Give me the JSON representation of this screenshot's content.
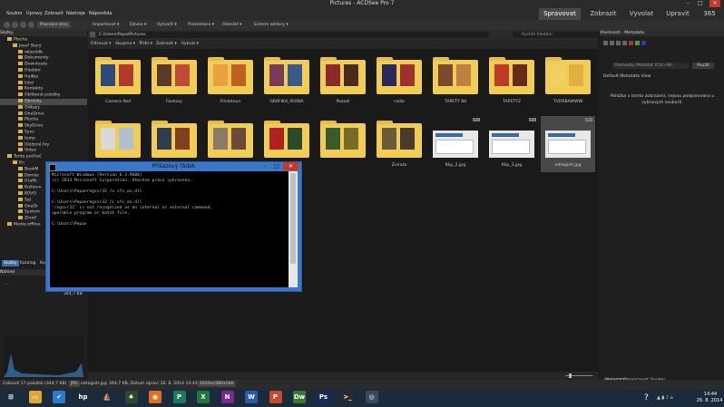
{
  "window": {
    "title": "Pictures - ACDSee Pro 7",
    "min": "–",
    "max": "□",
    "close": "✕"
  },
  "menu": [
    "Soubor",
    "Úpravy",
    "Zobrazit",
    "Nástroje",
    "Nápověda"
  ],
  "modes": [
    {
      "label": "Spravovat",
      "active": true
    },
    {
      "label": "Zobrazit"
    },
    {
      "label": "Vyvolat"
    },
    {
      "label": "Upravit"
    },
    {
      "label": "365"
    }
  ],
  "toolbar": {
    "items": [
      "Procesní stroj",
      "Importovat ▾",
      "Dávka ▾",
      "Vytvořit ▾",
      "Prezentace ▾",
      "Odeslat ▾",
      "Externí editory ▾"
    ]
  },
  "left_panel": {
    "header": "Složky",
    "tree": [
      {
        "label": "Plocha"
      },
      {
        "label": "Josef Starý"
      },
      {
        "label": "objectdb"
      },
      {
        "label": "Dokumenty"
      },
      {
        "label": "Downloads"
      },
      {
        "label": "Hledání"
      },
      {
        "label": "Hudba"
      },
      {
        "label": "Intel"
      },
      {
        "label": "Kontakty"
      },
      {
        "label": "Oblíbené položky"
      },
      {
        "label": "Obrázky",
        "selected": true
      },
      {
        "label": "Odkazy"
      },
      {
        "label": "OneDrive"
      },
      {
        "label": "Plocha"
      },
      {
        "label": "SkyDrive"
      },
      {
        "label": "Sync"
      },
      {
        "label": "temp"
      },
      {
        "label": "Uložené hry"
      },
      {
        "label": "Videa"
      },
      {
        "label": "Tento počítač"
      },
      {
        "label": "Kn"
      },
      {
        "label": "BookM"
      },
      {
        "label": "Domác"
      },
      {
        "label": "Grafik"
      },
      {
        "label": "Knihovn"
      },
      {
        "label": "KOVO"
      },
      {
        "label": "Sal"
      },
      {
        "label": "OneDr"
      },
      {
        "label": "System"
      },
      {
        "label": "ZinaV"
      },
      {
        "label": "Media offline"
      }
    ],
    "tabs": [
      "Složky",
      "Katalog",
      "Ka"
    ],
    "preview_header": "Náhled",
    "preview_placeholder": "--",
    "preview_size": "344,7 KB"
  },
  "path": "C:\\Users\\Pepa\\Pictures",
  "search_placeholder": "Rychlé hledání",
  "filter": [
    "Filtrovat ▾",
    "Skupina ▾",
    "Třídit ▾",
    "Zobrazit ▾",
    "Vybrat ▾"
  ],
  "thumbnails": [
    {
      "label": "Camera Roll",
      "kind": "folder",
      "pics": [
        "#2e4a7a",
        "#b03a2e"
      ]
    },
    {
      "label": "Fantasy",
      "kind": "folder",
      "pics": [
        "#5a3a2a",
        "#c04a3a"
      ]
    },
    {
      "label": "Flintstoun",
      "kind": "folder",
      "pics": [
        "#e8a040",
        "#c06020"
      ]
    },
    {
      "label": "GRAFIKA_PEKNA",
      "kind": "folder",
      "pics": [
        "#7a3a5a",
        "#3a5a8a"
      ]
    },
    {
      "label": "Pozadí",
      "kind": "folder",
      "pics": [
        "#8a2a2a",
        "#4a2a1a"
      ]
    },
    {
      "label": "radio",
      "kind": "folder",
      "pics": [
        "#2a2a5a",
        "#a03030"
      ]
    },
    {
      "label": "TAPETY 84",
      "kind": "folder",
      "pics": [
        "#7a4a2a",
        "#c08040"
      ]
    },
    {
      "label": "TAPETY2",
      "kind": "folder",
      "pics": [
        "#c03a2a",
        "#6a2a1a"
      ]
    },
    {
      "label": "TVORBAWWW",
      "kind": "folder",
      "pics": [
        "#f0d060",
        "#e0b040"
      ]
    },
    {
      "label": "",
      "kind": "folder",
      "pics": [
        "#d8d8d8",
        "#b0c0d0"
      ]
    },
    {
      "label": "",
      "kind": "folder",
      "pics": [
        "#303a50",
        "#804020"
      ]
    },
    {
      "label": "",
      "kind": "folder",
      "pics": [
        "#8a7a6a",
        "#6a4a3a"
      ]
    },
    {
      "label": "",
      "kind": "folder",
      "pics": [
        "#b02020",
        "#2a4a2a"
      ]
    },
    {
      "label": "",
      "kind": "folder",
      "pics": [
        "#3a5a2a",
        "#7a6a2a"
      ]
    },
    {
      "label": "Zvirata",
      "kind": "folder",
      "pics": [
        "#6a5a3a",
        "#4a3a2a"
      ]
    },
    {
      "label": "Klip_2.jpg",
      "kind": "jpg",
      "badge": "JPG"
    },
    {
      "label": "Klip_3.jpg",
      "kind": "jpg",
      "badge": "JPG"
    },
    {
      "label": "odregistr.jpg",
      "kind": "jpg",
      "badge": "JPG",
      "selected": true
    }
  ],
  "right_panel": {
    "header": "Vlastnosti - Metadata",
    "dropdown": "Předvolby Metadat (Ctrl+M)",
    "apply": "Použít",
    "view": "Default Metadata View",
    "message": "Položka v tomto zobrazení, nejsou podporována u vybraných souborů.",
    "tabs": [
      "Metadata",
      "Organizovat",
      "Soubor"
    ]
  },
  "status": {
    "count": "Celkově 17 položek (344,7 KB)",
    "type": "JPG",
    "file": "odregistr.jpg",
    "details": "344,7 KB, Datum úprav: 26. 8. 2014 14:43:52",
    "dims": "1920x1080x24b"
  },
  "cmd": {
    "title": "Příkazový řádek",
    "lines": [
      "Microsoft Windows [Version 6.3.9600]",
      "(c) 2013 Microsoft Corporation. Všechna práva vyhrazena.",
      "",
      "C:\\Users\\Pepa>regsvr32 /u sfc_os.dll",
      "",
      "C:\\Users\\Pepa>regsvr32 /i sfc_os.dll",
      "'regsvr32' is not recognized as an internal or external command,",
      "operable program or batch file.",
      "",
      "C:\\Users\\Pepa>"
    ]
  },
  "taskbar": {
    "apps": [
      {
        "name": "start",
        "label": "⊞",
        "color": "#1b2b3c"
      },
      {
        "name": "explorer",
        "label": "▭",
        "color": "#e0a830"
      },
      {
        "name": "check",
        "label": "✔",
        "color": "#2a7ad0"
      },
      {
        "name": "hp",
        "label": "hp",
        "color": "#1b2b3c"
      },
      {
        "name": "ship",
        "label": "⛵",
        "color": "#1b2b3c"
      },
      {
        "name": "game",
        "label": "♠",
        "color": "#2a4a2a"
      },
      {
        "name": "firefox",
        "label": "◉",
        "color": "#e07020"
      },
      {
        "name": "publisher",
        "label": "P",
        "color": "#1a7a5a"
      },
      {
        "name": "excel",
        "label": "X",
        "color": "#1e7a3a"
      },
      {
        "name": "onenote",
        "label": "N",
        "color": "#7a2a8a"
      },
      {
        "name": "word",
        "label": "W",
        "color": "#2a5aa8"
      },
      {
        "name": "powerpoint",
        "label": "P",
        "color": "#c84a2a"
      },
      {
        "name": "dreamweaver",
        "label": "Dw",
        "color": "#3a7a2a"
      },
      {
        "name": "photoshop",
        "label": "Ps",
        "color": "#1a2a5a"
      },
      {
        "name": "cmd",
        "label": ">_",
        "color": "#2a2a2a"
      },
      {
        "name": "acdsee",
        "label": "◎",
        "color": "#3a4a5a"
      }
    ],
    "time": "14:44",
    "date": "26. 8. 2014"
  }
}
